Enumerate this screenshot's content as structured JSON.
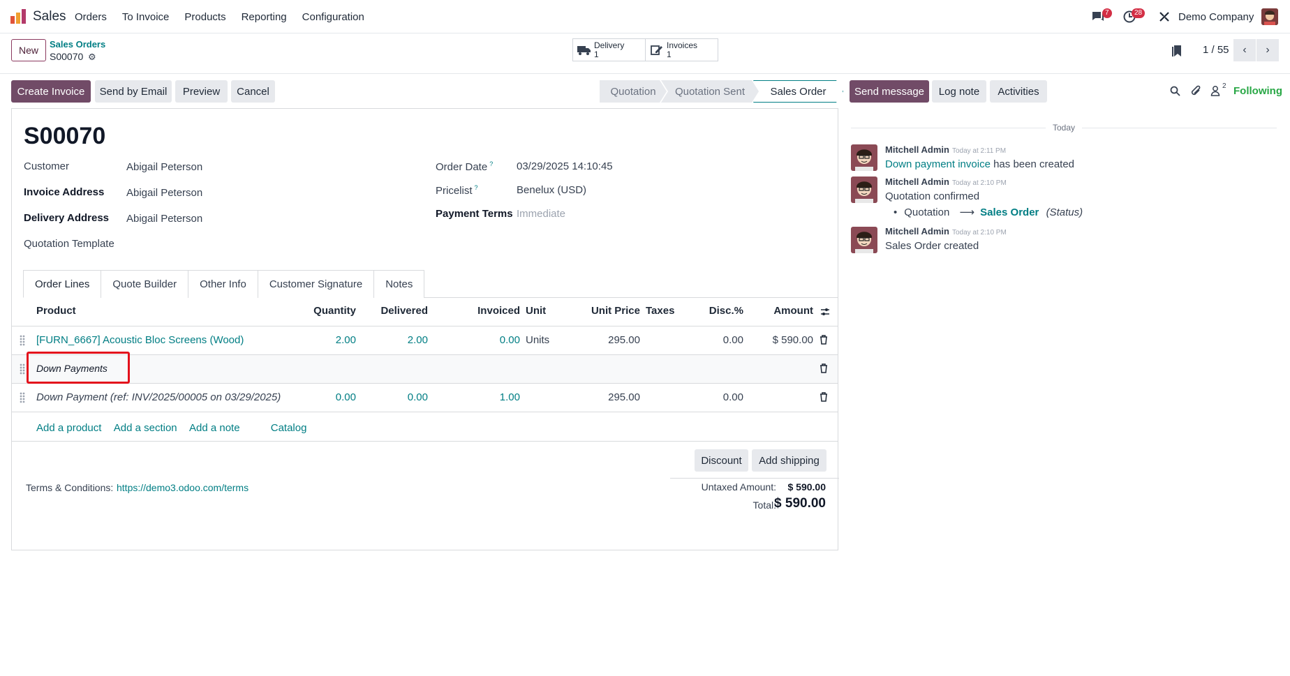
{
  "navbar": {
    "app_name": "Sales",
    "menu": [
      "Orders",
      "To Invoice",
      "Products",
      "Reporting",
      "Configuration"
    ],
    "messages_count": "7",
    "activities_count": "28",
    "company": "Demo Company"
  },
  "control": {
    "new_label": "New",
    "breadcrumb_parent": "Sales Orders",
    "breadcrumb_current": "S00070",
    "smart_buttons": [
      {
        "label": "Delivery",
        "count": "1",
        "icon": "truck-icon"
      },
      {
        "label": "Invoices",
        "count": "1",
        "icon": "edit-icon"
      }
    ],
    "pager": "1 / 55"
  },
  "actions": {
    "create_invoice": "Create Invoice",
    "send_email": "Send by Email",
    "preview": "Preview",
    "cancel": "Cancel"
  },
  "status": {
    "stages": [
      "Quotation",
      "Quotation Sent",
      "Sales Order"
    ],
    "active": "Sales Order"
  },
  "form": {
    "title": "S00070",
    "customer_label": "Customer",
    "customer": "Abigail Peterson",
    "invoice_address_label": "Invoice Address",
    "invoice_address": "Abigail Peterson",
    "delivery_address_label": "Delivery Address",
    "delivery_address": "Abigail Peterson",
    "quotation_template_label": "Quotation Template",
    "order_date_label": "Order Date",
    "order_date": "03/29/2025 14:10:45",
    "pricelist_label": "Pricelist",
    "pricelist": "Benelux (USD)",
    "payment_terms_label": "Payment Terms",
    "payment_terms": "Immediate",
    "help_mark": "?"
  },
  "tabs": [
    "Order Lines",
    "Quote Builder",
    "Other Info",
    "Customer Signature",
    "Notes"
  ],
  "table": {
    "headers": {
      "product": "Product",
      "quantity": "Quantity",
      "delivered": "Delivered",
      "invoiced": "Invoiced",
      "unit": "Unit",
      "unit_price": "Unit Price",
      "taxes": "Taxes",
      "disc": "Disc.%",
      "amount": "Amount"
    },
    "line1": {
      "product": "[FURN_6667] Acoustic Bloc Screens (Wood)",
      "quantity": "2.00",
      "delivered": "2.00",
      "invoiced": "0.00",
      "unit": "Units",
      "unit_price": "295.00",
      "disc": "0.00",
      "amount": "$ 590.00"
    },
    "section": "Down Payments",
    "line2": {
      "product": "Down Payment (ref: INV/2025/00005 on 03/29/2025)",
      "quantity": "0.00",
      "delivered": "0.00",
      "invoiced": "1.00",
      "unit_price": "295.00",
      "disc": "0.00"
    },
    "add_links": [
      "Add a product",
      "Add a section",
      "Add a note",
      "Catalog"
    ]
  },
  "footer": {
    "discount": "Discount",
    "add_shipping": "Add shipping",
    "terms_label": "Terms & Conditions:",
    "terms_link": "https://demo3.odoo.com/terms",
    "untaxed_label": "Untaxed Amount:",
    "untaxed": "$ 590.00",
    "total_label": "Total:",
    "total": "$ 590.00"
  },
  "chatter": {
    "send_message": "Send message",
    "log_note": "Log note",
    "activities": "Activities",
    "followers_count": "2",
    "following": "Following",
    "date_sep": "Today",
    "messages": [
      {
        "author": "Mitchell Admin",
        "time": "Today at 2:11 PM",
        "link": "Down payment invoice",
        "text": "has been created"
      },
      {
        "author": "Mitchell Admin",
        "time": "Today at 2:10 PM",
        "text": "Quotation confirmed",
        "change_from": "Quotation",
        "change_to": "Sales Order",
        "field": "(Status)"
      },
      {
        "author": "Mitchell Admin",
        "time": "Today at 2:10 PM",
        "text": "Sales Order created"
      }
    ]
  },
  "colors": {
    "brand": "#714b67",
    "link": "#017e84",
    "highlight": "#e3111c"
  }
}
